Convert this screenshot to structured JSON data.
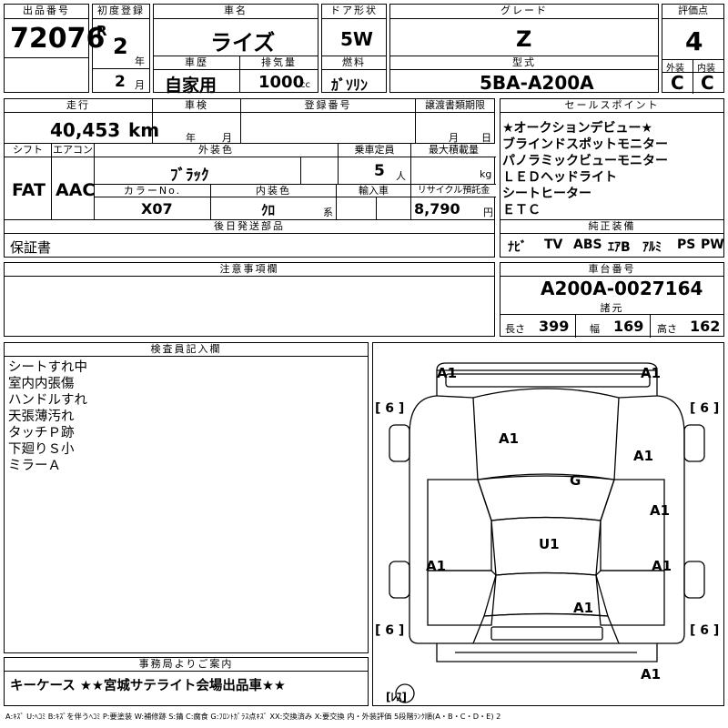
{
  "header": {
    "lot_label": "出品番号",
    "lot": "72076",
    "reg_label": "初度登録",
    "era": "R",
    "reg_year": "2",
    "year_unit": "年",
    "reg_month": "2",
    "month_unit": "月",
    "name_label": "車名",
    "car_name": "ライズ",
    "doors_label": "ドア形状",
    "doors": "5W",
    "grade_label": "グレード",
    "grade": "Z",
    "score_label": "評価点",
    "score": "4",
    "hist_label": "車歴",
    "history": "自家用",
    "disp_label": "排気量",
    "displacement": "1000",
    "disp_unit": "cc",
    "fuel_label": "燃料",
    "fuel": "ｶﾞｿﾘﾝ",
    "model_label": "型式",
    "model": "5BA-A200A",
    "ext_label": "外装",
    "ext_grade": "C",
    "int_label": "内装",
    "int_grade": "C"
  },
  "row2": {
    "mileage_label": "走行",
    "mileage": "40,453",
    "mileage_unit": "km",
    "inspect_label": "車検",
    "year_unit": "年",
    "month_unit": "月",
    "regno_label": "登録番号",
    "transfer_label": "譲渡書類期限",
    "transfer_month": "月",
    "transfer_day": "日",
    "shift_label": "シフト",
    "shift": "FAT",
    "ac_label": "エアコン",
    "ac": "AAC",
    "color_label": "外装色",
    "color": "ﾌﾞﾗｯｸ",
    "seats_label": "乗車定員",
    "seats": "5",
    "seats_unit": "人",
    "load_label": "最大積載量",
    "load_unit": "kg",
    "colorno_label": "カラーNo.",
    "color_no": "X07",
    "intcolor_label": "内装色",
    "int_color": "ｸﾛ",
    "int_color_unit": "系",
    "import_label": "輸入車",
    "recycle_label": "リサイクル預託金",
    "recycle": "8,790",
    "recycle_unit": "円",
    "later_label": "後日発送部品",
    "later_item": "保証書"
  },
  "sales": {
    "label": "セールスポイント",
    "items": [
      "★オークションデビュー★",
      "ブラインドスポットモニター",
      "パノラミックビューモニター",
      "ＬＥＤヘッドライト",
      "シートヒーター",
      "ＥＴＣ"
    ]
  },
  "equipment": {
    "label": "純正装備",
    "items": [
      "ﾅﾋﾞ",
      "TV",
      "ABS",
      "ｴｱB",
      "ｱﾙﾐ",
      "PS",
      "PW"
    ]
  },
  "notes_label": "注意事項欄",
  "chassis": {
    "label": "車台番号",
    "number": "A200A-0027164",
    "dims_label": "諸元",
    "length_label": "長さ",
    "length": "399",
    "width_label": "幅",
    "width": "169",
    "height_label": "高さ",
    "height": "162"
  },
  "inspector": {
    "label": "検査員記入欄",
    "lines": [
      "シートすれ中",
      "室内内張傷",
      "ハンドルすれ",
      "天張薄汚れ",
      "タッチＰ跡",
      "下廻りＳ小",
      "ミラーＡ"
    ]
  },
  "office": {
    "label": "事務局よりご案内",
    "text": "キーケース ★★宮城サテライト会場出品車★★"
  },
  "diagram": {
    "marks": {
      "front_left": "A1",
      "front_right": "A1",
      "hood": "A1",
      "right_fender": "A1",
      "windshield": "G",
      "right_front_door": "A1",
      "roof": "U1",
      "left_rear_door": "A1",
      "right_rear_door": "A1",
      "rear_glass": "A1",
      "rear": "A1"
    },
    "tire_tl": "[ 6 ]",
    "tire_tr": "[ 6 ]",
    "tire_bl": "[ 6 ]",
    "tire_br": "[ 6 ]",
    "spare": "[ﾚｽ]"
  },
  "legend": "A:ｷｽﾞ U:ﾍｺﾐ B:ｷｽﾞを伴うﾍｺﾐ P:要塗装 W:補修跡 S:錆 C:腐食 G:ﾌﾛﾝﾄｶﾞﾗｽ点ｷｽﾞ XX:交換済み X:要交換 内・外装評価 5段階ﾗﾝｸ順(A・B・C・D・E) 2"
}
